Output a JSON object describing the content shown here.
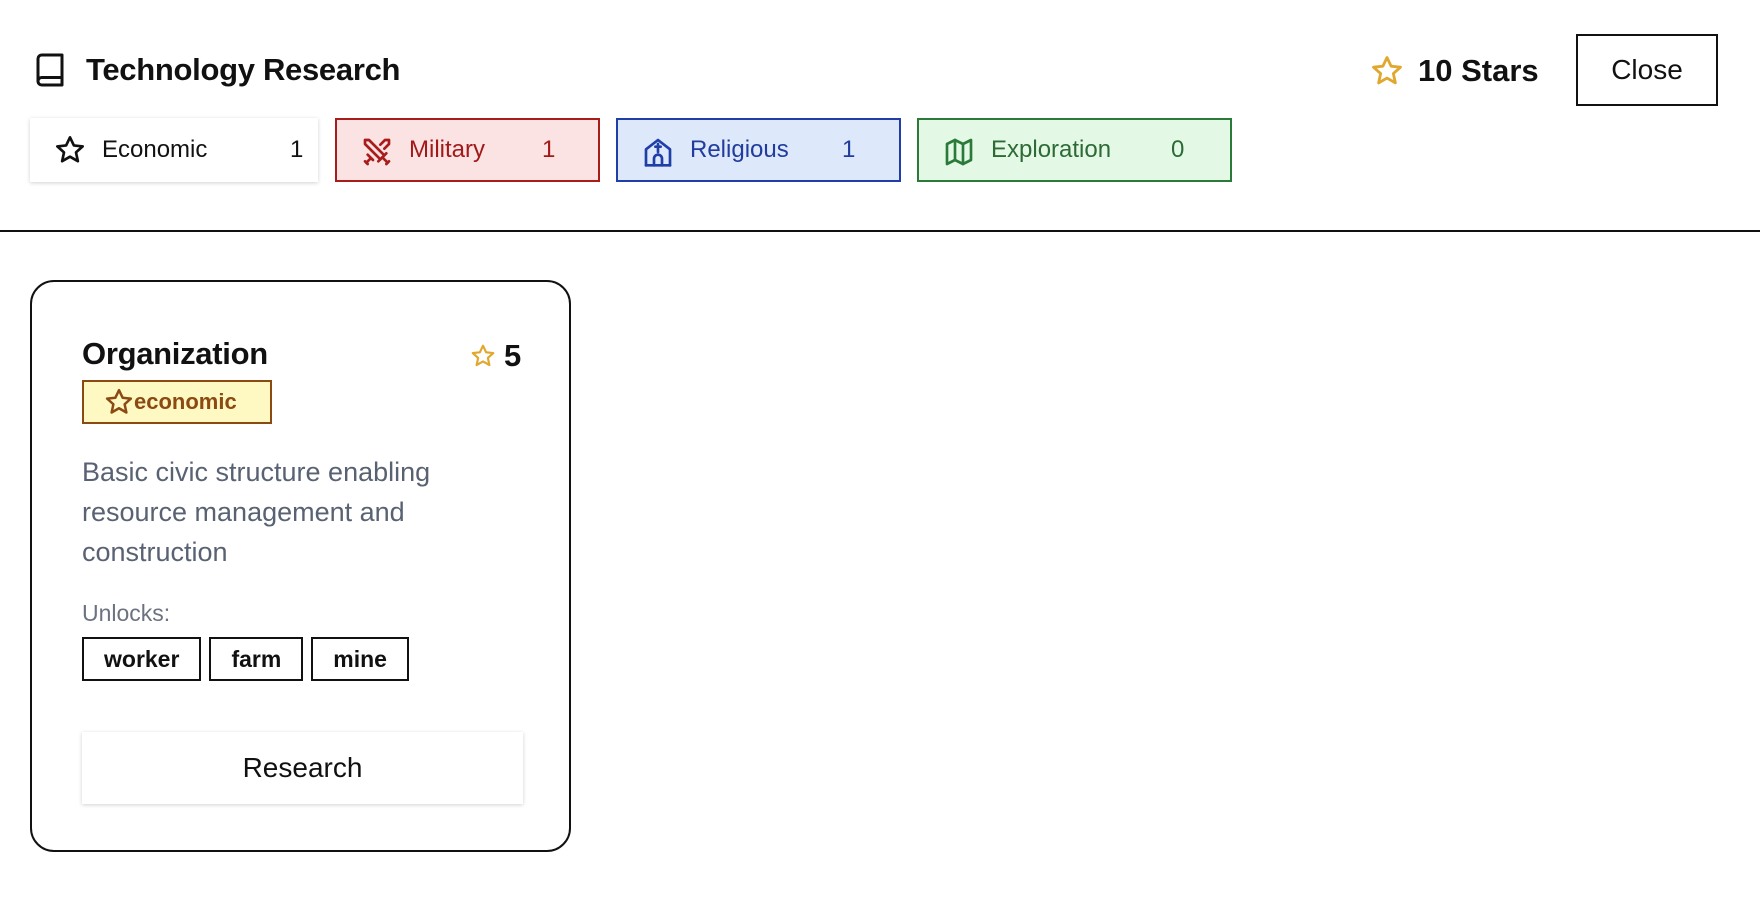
{
  "header": {
    "title": "Technology Research",
    "title_icon": "book-icon",
    "stars_label": "10 Stars",
    "stars_icon": "star-icon",
    "close_label": "Close"
  },
  "categories": [
    {
      "label": "Economic",
      "count": "1",
      "icon": "star-icon",
      "color": "#111111",
      "bg": "#ffffff"
    },
    {
      "label": "Military",
      "count": "1",
      "icon": "crossed-swords-icon",
      "color": "#a81c1c",
      "bg": "#fbe3e4"
    },
    {
      "label": "Religious",
      "count": "1",
      "icon": "church-icon",
      "color": "#1f3ea8",
      "bg": "#dde8fa"
    },
    {
      "label": "Exploration",
      "count": "0",
      "icon": "map-icon",
      "color": "#2b7a3a",
      "bg": "#e3f9e6"
    }
  ],
  "tech_card": {
    "title": "Organization",
    "cost": "5",
    "cost_icon": "star-icon",
    "category_badge": "economic",
    "description": "Basic civic structure enabling resource management and construction",
    "unlocks_label": "Unlocks:",
    "unlocks": [
      "worker",
      "farm",
      "mine"
    ],
    "action_label": "Research"
  },
  "colors": {
    "star_gold": "#e0a82e",
    "badge_bg": "#fef8c3",
    "badge_text": "#8a4a12",
    "muted_text": "#596272"
  }
}
